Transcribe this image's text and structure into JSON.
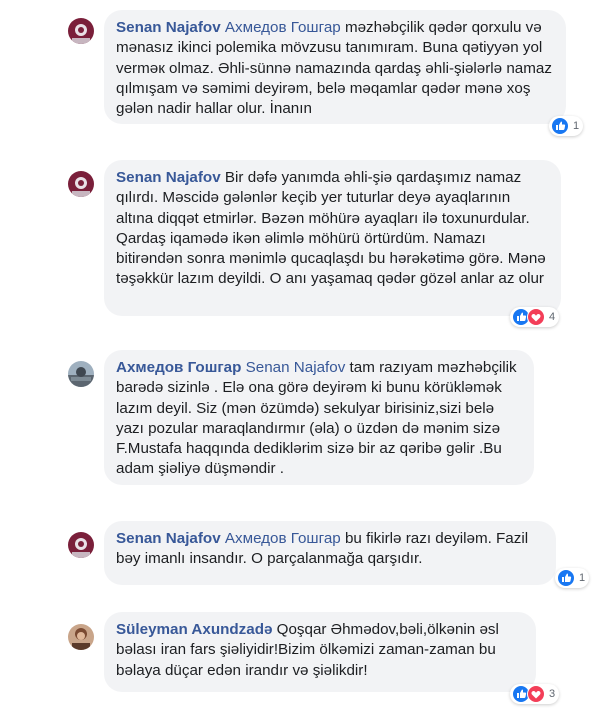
{
  "colors": {
    "author": "#385898",
    "bubble": "#f2f3f5",
    "like": "#1877f2",
    "love": "#f33e58"
  },
  "comments": [
    {
      "author": "Senan Najafov",
      "mention": "Ахмедов Гошгар",
      "text": "məzhəbçilik qədər qorxulu və mənasız ikinci polemika mövzusu tanımıram. Buna qətiyyən yol verməк olmaz. Əhli-sünnə namazında qardaş əhli-şiələrlə namaz qılmışam və səmimi deyirəm, belə məqamlar qədər mənə xoş gələn nadir hallar olur. İnanın",
      "reactions": [
        "like-icon"
      ],
      "reaction_count": "1"
    },
    {
      "author": "Senan Najafov",
      "mention": "",
      "text": "Bir dəfə yanımda əhli-şiə qardaşımız namaz qılırdı. Məscidə gələnlər keçib yer tuturlar deyə ayaqlarının altına diqqət etmirlər. Bəzən möhürə ayaqları ilə toxunurdular. Qardaş iqamədə ikən əlimlə möhürü örtürdüm. Namazı bitirəndən sonra mənimlə qucaqlaşdı bu hərəkətimə görə. Mənə təşəkkür lazım deyildi. O anı yaşamaq qədər gözəl anlar az olur",
      "reactions": [
        "like-icon",
        "love-icon"
      ],
      "reaction_count": "4"
    },
    {
      "author": "Ахмедов Гошгар",
      "mention": "Senan Najafov",
      "text": "tam razıyam məzhəbçilik barədə sizinlə . Elə ona görə deyirəm ki bunu körükləmək lazım deyil. Siz (mən özümdə) sekulyar birisiniz,sizi belə yazı pozular maraqlandırmır (əla) o üzdən də mənim sizə F.Mustafa haqqında dediklərim sizə bir az qəribə gəlir .Bu adam şiəliyə düşməndir .",
      "reactions": [],
      "reaction_count": ""
    },
    {
      "author": "Senan Najafov",
      "mention": "Ахмедов Гошгар",
      "text": "bu fikirlə razı deyiləm. Fazil bəy imanlı insandır. O parçalanmağa qarşıdır.",
      "reactions": [
        "like-icon"
      ],
      "reaction_count": "1"
    },
    {
      "author": "Süleyman Axundzadə",
      "mention": "",
      "text": "Qoşqar Əhmədov,bəli,ölkənin əsl bəlası iran fars şiəliyidir!Bizim ölkəmizi zaman-zaman bu bəlaya düçar edən irandır və şiəlikdir!",
      "reactions": [
        "like-icon",
        "love-icon"
      ],
      "reaction_count": "3"
    }
  ]
}
